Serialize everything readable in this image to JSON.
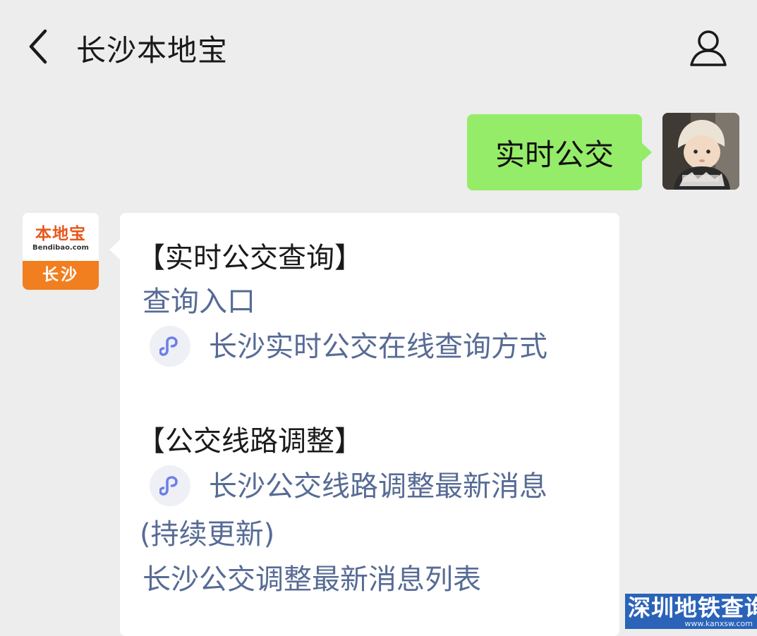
{
  "header": {
    "title": "长沙本地宝",
    "back_icon": "chevron-left-icon",
    "profile_icon": "user-icon"
  },
  "chat": {
    "user_message": "实时公交",
    "bot_avatar": {
      "logo_text": "本地宝",
      "logo_sub": "Bendibao.com",
      "city": "长沙"
    },
    "reply": {
      "section1_heading": "【实时公交查询】",
      "query_entry": "查询入口",
      "mini_link_1": "长沙实时公交在线查询方式",
      "section2_heading": "【公交线路调整】",
      "mini_link_2_line1": "长沙公交线路调整最新消息",
      "mini_link_2_line2": "(持续更新)",
      "list_link": "长沙公交调整最新消息列表"
    }
  },
  "watermark": {
    "title": "深圳地铁查询",
    "url": "www.kanxsw.com"
  },
  "colors": {
    "background": "#ededed",
    "user_bubble": "#95ec69",
    "link": "#576b95",
    "brand_orange": "#f17e1f"
  }
}
